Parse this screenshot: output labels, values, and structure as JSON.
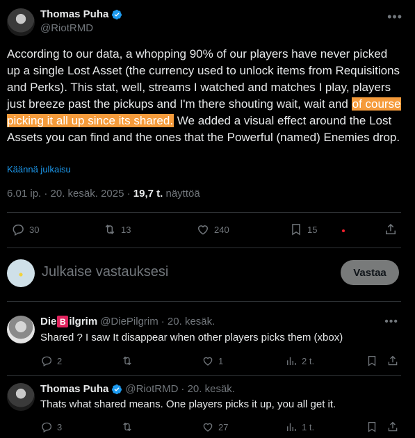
{
  "tweet": {
    "author_name": "Thomas Puha",
    "author_handle": "@RiotRMD",
    "text_before": "According to our data, a whopping 90% of our players have never picked up a single Lost Asset (the currency used to unlock items from Requisitions and Perks). This stat, well, streams I watched and matches I play, players just breeze past the pickups and I'm there shouting wait, wait and ",
    "text_highlight": "of course picking it all up since its shared.",
    "text_after": " We added a visual effect around the Lost Assets you can find and the ones that the Powerful (named) Enemies drop.",
    "translate_label": "Käännä julkaisu",
    "timestamp": "6.01 ip. · 20. kesäk. 2025 · ",
    "views_count": "19,7 t.",
    "views_label": " näyttöä",
    "stats": {
      "replies": "30",
      "reposts": "13",
      "likes": "240",
      "bookmarks": "15"
    }
  },
  "composer": {
    "placeholder": "Julkaise vastauksesi",
    "reply_button": "Vastaa"
  },
  "replies": [
    {
      "name_prefix": "Die",
      "name_badge": "B",
      "name_suffix": "ilgrim",
      "handle": "@DiePilgrim",
      "date": "· 20. kesäk.",
      "text": "Shared ? I saw It disappear when other players picks them (xbox)",
      "replies": "2",
      "likes": "1",
      "views": "2 t."
    },
    {
      "name": "Thomas Puha",
      "handle": "@RiotRMD",
      "date": "· 20. kesäk.",
      "text": "Thats what shared means. One players picks it up, you all get it.",
      "replies": "3",
      "likes": "27",
      "views": "1 t."
    }
  ],
  "colors": {
    "background": "#000000",
    "accent": "#1d9bf0",
    "highlight": "#f59b3b",
    "muted": "#71767b"
  }
}
